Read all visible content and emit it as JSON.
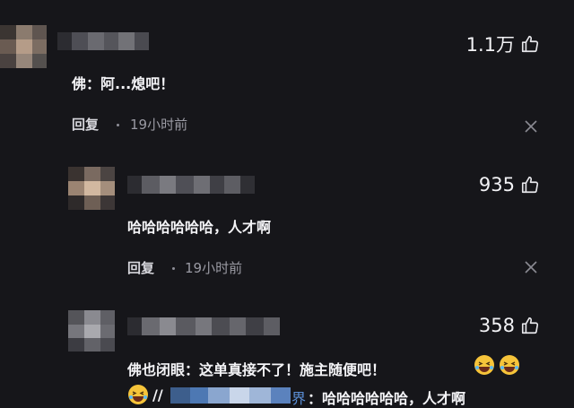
{
  "comments": [
    {
      "like_count": "1.1万",
      "text": "佛：阿...熄吧！",
      "reply_label": "回复",
      "time": "19小时前"
    },
    {
      "like_count": "935",
      "text": "哈哈哈哈哈哈，人才啊",
      "reply_label": "回复",
      "time": "19小时前"
    },
    {
      "like_count": "358",
      "text_line1": "佛也闭眼：这单真接不了！施主随便吧！",
      "mention_prefix": "//",
      "mention_suffix": "界",
      "text_line2": "：哈哈哈哈哈哈，人才啊"
    }
  ],
  "icons": [
    "thumbs-up-icon",
    "close-icon",
    "laughing-emoji-icon"
  ],
  "colors": {
    "background": "#16161a",
    "text": "#f4f4f7",
    "muted": "#9a9aa3",
    "mention": "#5b8fd6"
  }
}
